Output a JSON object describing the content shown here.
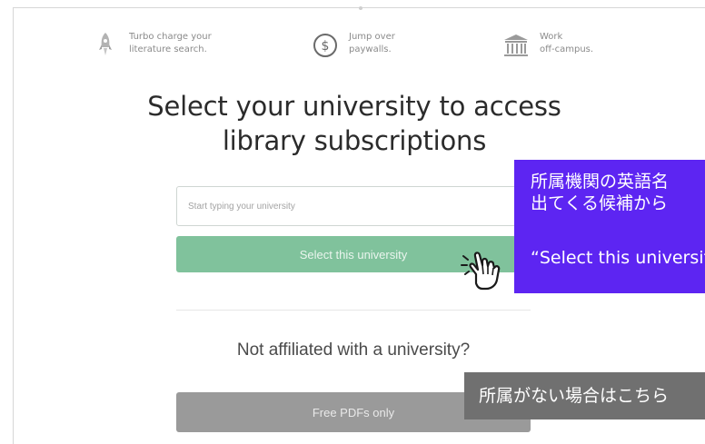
{
  "benefits": [
    {
      "icon": "rocket-icon",
      "line1": "Turbo charge your",
      "line2": "literature search."
    },
    {
      "icon": "dollar-icon",
      "line1": "Jump over",
      "line2": "paywalls."
    },
    {
      "icon": "library-icon",
      "line1": "Work",
      "line2": "off-campus."
    }
  ],
  "headline": {
    "line1": "Select your university to access",
    "line2": "library subscriptions"
  },
  "search": {
    "placeholder": "Start typing your university",
    "value": ""
  },
  "select_button": "Select this university",
  "not_affiliated": "Not affiliated with a university?",
  "free_button": "Free PDFs only",
  "annotations": {
    "note1": {
      "line1": "所属機関の英語名",
      "line2": "出てくる候補から",
      "line3": "“Select this university"
    },
    "note2": {
      "line1": "所属がない場合はこちら"
    }
  },
  "colors": {
    "select_button": "#80c29c",
    "free_button": "#9a9a9a",
    "note_purple": "#5d25f2",
    "note_gray": "#707070"
  }
}
